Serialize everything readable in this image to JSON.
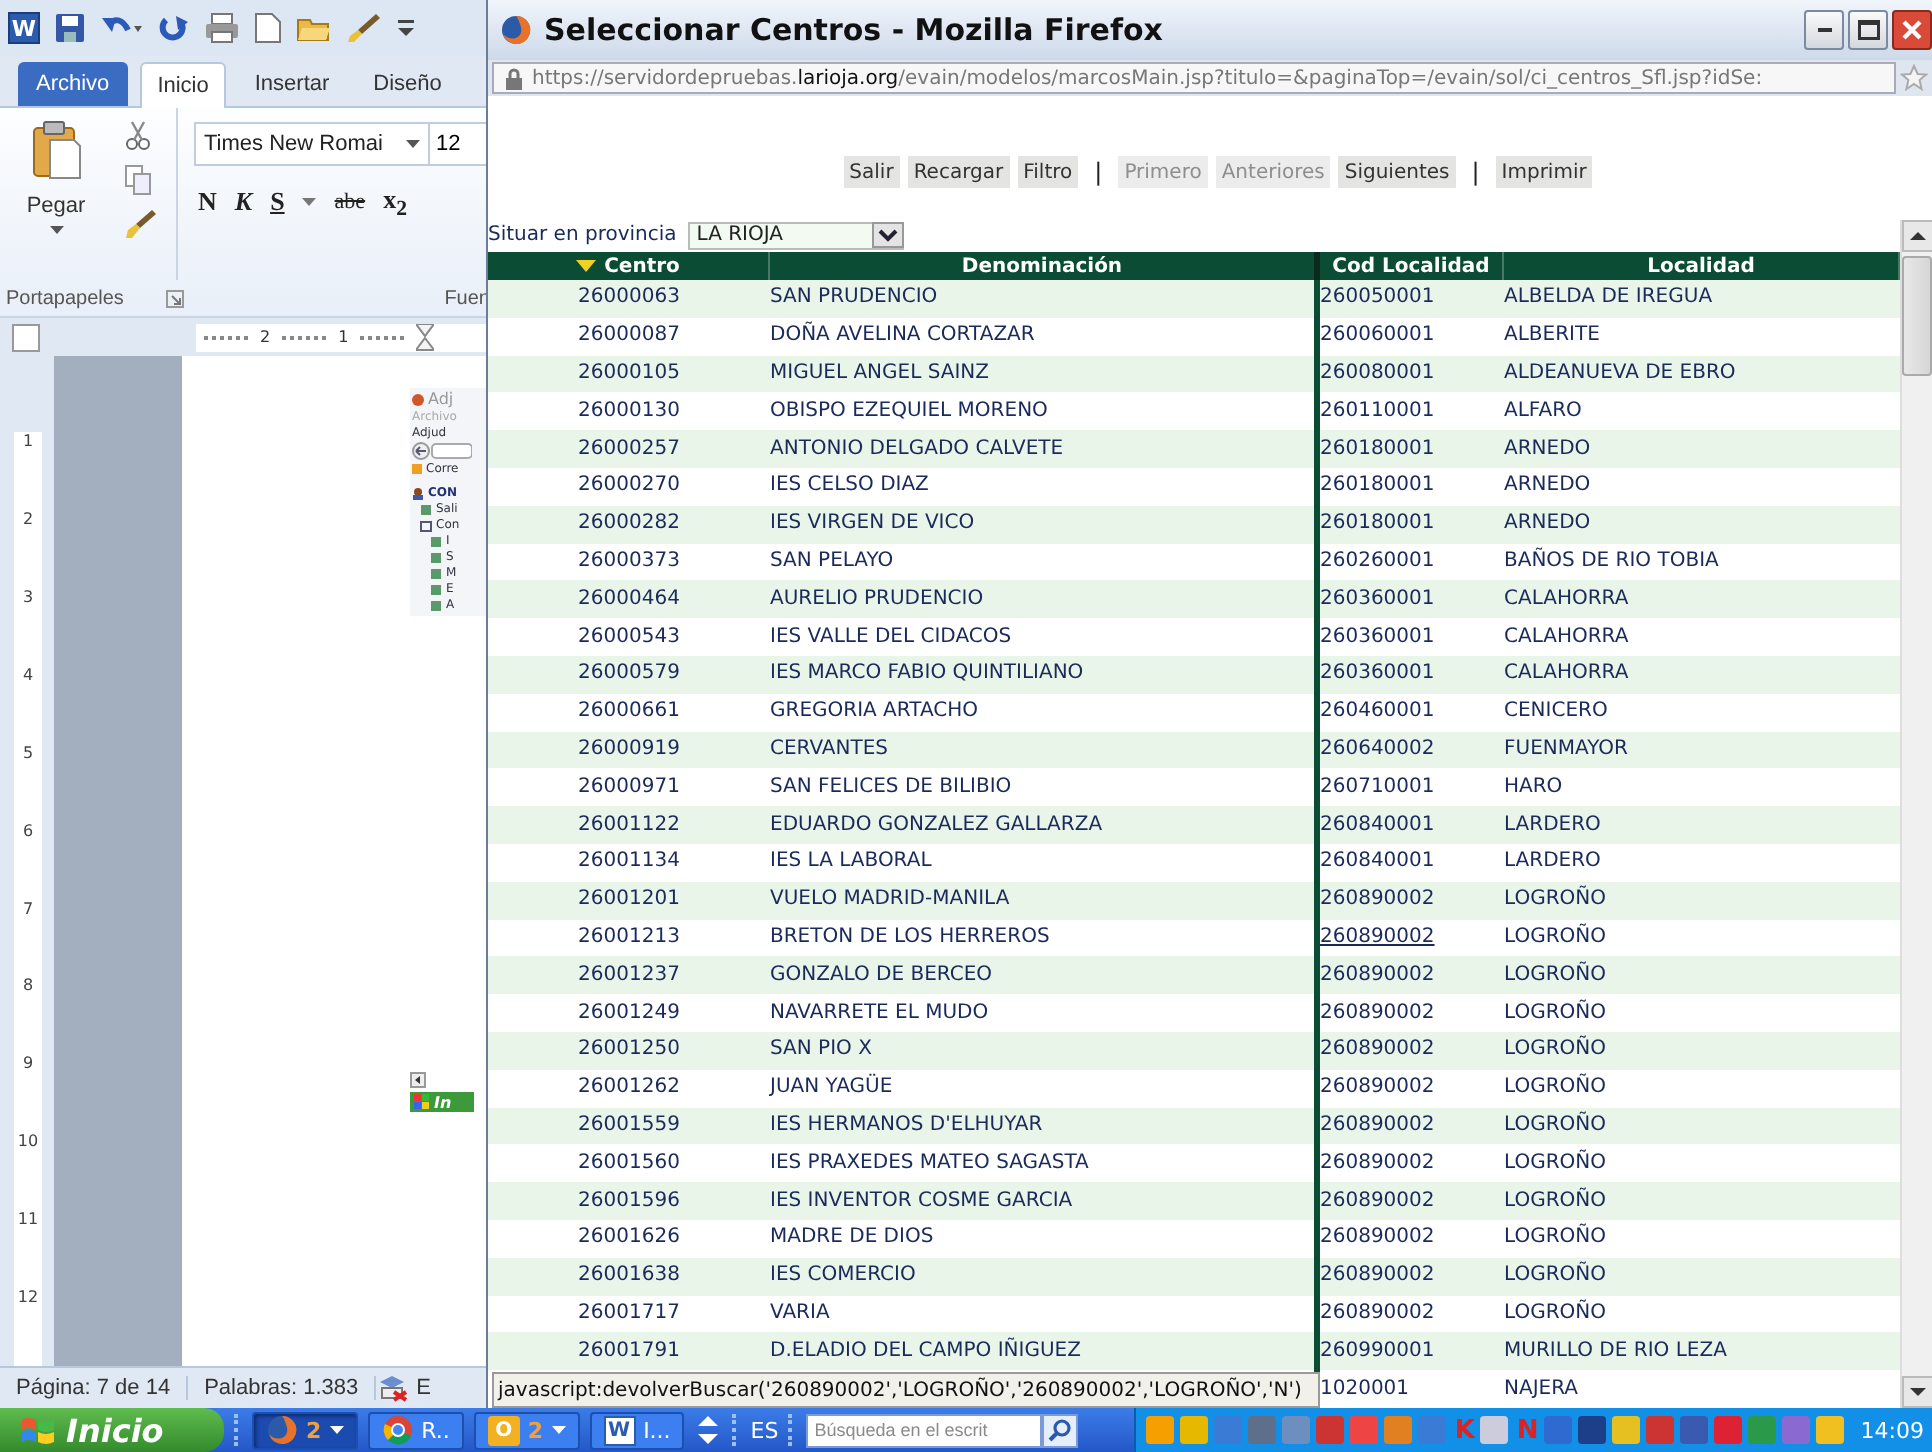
{
  "word": {
    "logo_letter": "W",
    "ribbon_tabs": [
      {
        "label": "Archivo",
        "kind": "file",
        "selected": false
      },
      {
        "label": "Inicio",
        "kind": "tab",
        "selected": true
      },
      {
        "label": "Insertar",
        "kind": "tab",
        "selected": false
      },
      {
        "label": "Diseño",
        "kind": "tab",
        "selected": false
      }
    ],
    "paste_label": "Pegar",
    "font_name": "Times New Romai",
    "font_size": "12",
    "format_buttons": [
      {
        "text": "N",
        "kind": "bold"
      },
      {
        "text": "K",
        "kind": "italic"
      },
      {
        "text": "S",
        "kind": "underline"
      },
      {
        "text": "abe",
        "kind": "strike"
      },
      {
        "text": "x$_{2}$",
        "kind": "subscript"
      }
    ],
    "group_labels": [
      "Portapapeles",
      "Fuen"
    ],
    "ruler_numbers": [
      "2",
      "1"
    ],
    "vertical_ruler_numbers": [
      "1",
      "2",
      "3",
      "4",
      "5",
      "6",
      "7",
      "8",
      "9",
      "10",
      "11",
      "12"
    ],
    "embedded_window": {
      "title": "Adj",
      "menu": "Archivo",
      "tab": "Adjud",
      "bookmark": "Corre",
      "tree": [
        {
          "label": "CON",
          "children": [
            {
              "label": "Sali"
            },
            {
              "label": "Con",
              "children": [
                {
                  "label": "I"
                },
                {
                  "label": "S"
                },
                {
                  "label": "M"
                },
                {
                  "label": "E"
                },
                {
                  "label": "A"
                }
              ]
            }
          ]
        }
      ]
    },
    "embedded_taskbar": {
      "start_label": "In"
    },
    "status_bar": {
      "page": "Página: 7 de 14",
      "words": "Palabras: 1.383",
      "next": "E"
    }
  },
  "browser": {
    "title": "Seleccionar Centros - Mozilla Firefox",
    "url_parts": [
      {
        "text": "https://servidordepruebas.",
        "highlighted": false
      },
      {
        "text": "larioja.org",
        "highlighted": true
      },
      {
        "text": "/evain/modelos/marcosMain.jsp?titulo=&paginaTop=/evain/sol/ci_centros_Sfl.jsp?idSe:",
        "highlighted": false
      }
    ],
    "toolbar": [
      {
        "label": "Salir",
        "kind": "button",
        "disabled": false
      },
      {
        "label": "Recargar",
        "kind": "button",
        "disabled": false
      },
      {
        "label": "Filtro",
        "kind": "button",
        "disabled": false
      },
      {
        "label": "|",
        "kind": "separator"
      },
      {
        "label": "Primero",
        "kind": "button",
        "disabled": true
      },
      {
        "label": "Anteriores",
        "kind": "button",
        "disabled": true
      },
      {
        "label": "Siguientes",
        "kind": "button",
        "disabled": false
      },
      {
        "label": "|",
        "kind": "separator"
      },
      {
        "label": "Imprimir",
        "kind": "button",
        "disabled": false
      }
    ],
    "province_label": "Situar en provincia",
    "province_value": "LA RIOJA",
    "columns": [
      {
        "label": "Centro",
        "sorted": true
      },
      {
        "label": "Denominación",
        "sorted": false
      },
      {
        "label": "Cod Localidad",
        "sorted": false
      },
      {
        "label": "Localidad",
        "sorted": false
      }
    ],
    "rows": [
      {
        "centro": "26000063",
        "denominacion": "SAN PRUDENCIO",
        "cod_localidad": "260050001",
        "localidad": "ALBELDA DE IREGUA",
        "hovered": false
      },
      {
        "centro": "26000087",
        "denominacion": "DOÑA AVELINA CORTAZAR",
        "cod_localidad": "260060001",
        "localidad": "ALBERITE",
        "hovered": false
      },
      {
        "centro": "26000105",
        "denominacion": "MIGUEL ANGEL SAINZ",
        "cod_localidad": "260080001",
        "localidad": "ALDEANUEVA DE EBRO",
        "hovered": false
      },
      {
        "centro": "26000130",
        "denominacion": "OBISPO EZEQUIEL MORENO",
        "cod_localidad": "260110001",
        "localidad": "ALFARO",
        "hovered": false
      },
      {
        "centro": "26000257",
        "denominacion": "ANTONIO DELGADO CALVETE",
        "cod_localidad": "260180001",
        "localidad": "ARNEDO",
        "hovered": false
      },
      {
        "centro": "26000270",
        "denominacion": "IES CELSO DIAZ",
        "cod_localidad": "260180001",
        "localidad": "ARNEDO",
        "hovered": false
      },
      {
        "centro": "26000282",
        "denominacion": "IES VIRGEN DE VICO",
        "cod_localidad": "260180001",
        "localidad": "ARNEDO",
        "hovered": false
      },
      {
        "centro": "26000373",
        "denominacion": "SAN PELAYO",
        "cod_localidad": "260260001",
        "localidad": "BAÑOS DE RIO TOBIA",
        "hovered": false
      },
      {
        "centro": "26000464",
        "denominacion": "AURELIO PRUDENCIO",
        "cod_localidad": "260360001",
        "localidad": "CALAHORRA",
        "hovered": false
      },
      {
        "centro": "26000543",
        "denominacion": "IES VALLE DEL CIDACOS",
        "cod_localidad": "260360001",
        "localidad": "CALAHORRA",
        "hovered": false
      },
      {
        "centro": "26000579",
        "denominacion": "IES MARCO FABIO QUINTILIANO",
        "cod_localidad": "260360001",
        "localidad": "CALAHORRA",
        "hovered": false
      },
      {
        "centro": "26000661",
        "denominacion": "GREGORIA ARTACHO",
        "cod_localidad": "260460001",
        "localidad": "CENICERO",
        "hovered": false
      },
      {
        "centro": "26000919",
        "denominacion": "CERVANTES",
        "cod_localidad": "260640002",
        "localidad": "FUENMAYOR",
        "hovered": false
      },
      {
        "centro": "26000971",
        "denominacion": "SAN FELICES DE BILIBIO",
        "cod_localidad": "260710001",
        "localidad": "HARO",
        "hovered": false
      },
      {
        "centro": "26001122",
        "denominacion": "EDUARDO GONZALEZ GALLARZA",
        "cod_localidad": "260840001",
        "localidad": "LARDERO",
        "hovered": false
      },
      {
        "centro": "26001134",
        "denominacion": "IES LA LABORAL",
        "cod_localidad": "260840001",
        "localidad": "LARDERO",
        "hovered": false
      },
      {
        "centro": "26001201",
        "denominacion": "VUELO MADRID-MANILA",
        "cod_localidad": "260890002",
        "localidad": "LOGROÑO",
        "hovered": false
      },
      {
        "centro": "26001213",
        "denominacion": "BRETON DE LOS HERREROS",
        "cod_localidad": "260890002",
        "localidad": "LOGROÑO",
        "hovered": true
      },
      {
        "centro": "26001237",
        "denominacion": "GONZALO DE BERCEO",
        "cod_localidad": "260890002",
        "localidad": "LOGROÑO",
        "hovered": false
      },
      {
        "centro": "26001249",
        "denominacion": "NAVARRETE EL MUDO",
        "cod_localidad": "260890002",
        "localidad": "LOGROÑO",
        "hovered": false
      },
      {
        "centro": "26001250",
        "denominacion": "SAN PIO X",
        "cod_localidad": "260890002",
        "localidad": "LOGROÑO",
        "hovered": false
      },
      {
        "centro": "26001262",
        "denominacion": "JUAN YAGÜE",
        "cod_localidad": "260890002",
        "localidad": "LOGROÑO",
        "hovered": false
      },
      {
        "centro": "26001559",
        "denominacion": "IES HERMANOS D'ELHUYAR",
        "cod_localidad": "260890002",
        "localidad": "LOGROÑO",
        "hovered": false
      },
      {
        "centro": "26001560",
        "denominacion": "IES PRAXEDES MATEO SAGASTA",
        "cod_localidad": "260890002",
        "localidad": "LOGROÑO",
        "hovered": false
      },
      {
        "centro": "26001596",
        "denominacion": "IES INVENTOR COSME GARCIA",
        "cod_localidad": "260890002",
        "localidad": "LOGROÑO",
        "hovered": false
      },
      {
        "centro": "26001626",
        "denominacion": "MADRE DE DIOS",
        "cod_localidad": "260890002",
        "localidad": "LOGROÑO",
        "hovered": false
      },
      {
        "centro": "26001638",
        "denominacion": "IES COMERCIO",
        "cod_localidad": "260890002",
        "localidad": "LOGROÑO",
        "hovered": false
      },
      {
        "centro": "26001717",
        "denominacion": "VARIA",
        "cod_localidad": "260890002",
        "localidad": "LOGROÑO",
        "hovered": false
      },
      {
        "centro": "26001791",
        "denominacion": "D.ELADIO DEL CAMPO IÑIGUEZ",
        "cod_localidad": "260990001",
        "localidad": "MURILLO DE RIO LEZA",
        "hovered": false
      },
      {
        "cod_localidad": "1020001",
        "localidad": "NAJERA",
        "hovered": false
      }
    ],
    "status_text": "javascript:devolverBuscar('260890002','LOGROÑO','260890002','LOGROÑO','N')"
  },
  "taskbar": {
    "start_label": "Inicio",
    "buttons": [
      {
        "label": "2",
        "kind": "firefox",
        "selected": true
      },
      {
        "label": "R..",
        "kind": "chrome",
        "selected": false
      },
      {
        "label": "2",
        "kind": "outlook",
        "icon_letter": "O",
        "selected": false
      },
      {
        "label": "I...",
        "kind": "word",
        "icon_letter": "W",
        "selected": false
      }
    ],
    "language": "ES",
    "search_placeholder": "Búsqueda en el escrit",
    "tray_letters": [
      "K",
      "N"
    ],
    "clock": "14:09"
  }
}
